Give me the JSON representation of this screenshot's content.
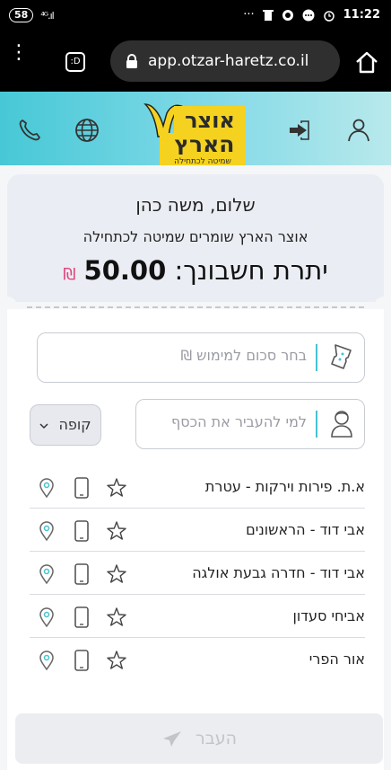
{
  "status_bar": {
    "battery": "58",
    "signal": "⁴ᴳ.ıl",
    "more": "···",
    "time": "11:22"
  },
  "browser": {
    "url": "app.otzar-haretz.co.il",
    "tabs_label": ":D"
  },
  "header": {
    "logo_line1": "אוצר",
    "logo_line2": "הארץ",
    "logo_tagline": "שמיטה לכתחילה"
  },
  "account": {
    "greeting": "שלום,",
    "name": "משה כהן",
    "tagline": "אוצר הארץ שומרים שמיטה לכתחילה",
    "balance_label": "יתרת חשבונך:",
    "balance_amount": "50.00",
    "currency": "₪"
  },
  "form": {
    "amount_placeholder": "בחר סכום למימוש ₪",
    "recipient_placeholder": "למי להעביר את הכסף",
    "select_value": "קופה"
  },
  "stores": [
    {
      "name": "א.ת. פירות וירקות - עטרת"
    },
    {
      "name": "אבי דוד - הראשונים"
    },
    {
      "name": "אבי דוד - חדרה גבעת אולגה"
    },
    {
      "name": "אביחי סעדון"
    },
    {
      "name": "אור הפרי"
    }
  ],
  "submit": {
    "label": "העבר"
  },
  "colors": {
    "accent": "#46c2d1",
    "currency": "#e0457b",
    "logo_yellow": "#f5d21f"
  }
}
